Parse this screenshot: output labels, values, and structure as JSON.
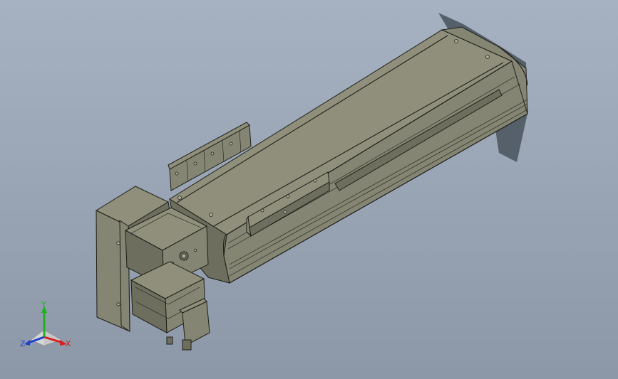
{
  "viewport": {
    "background_top": "#a6b2c2",
    "background_bottom": "#8c98a8"
  },
  "model": {
    "body_color": "#858573",
    "top_face_color": "#8f8f7c",
    "dark_face_color": "#6e6e5e",
    "edge_color": "#1e1e18",
    "shadow_color": "#55606a"
  },
  "triad": {
    "x_label": "X",
    "y_label": "Y",
    "z_label": "Z",
    "x_color": "#d42020",
    "y_color": "#20b020",
    "z_color": "#2040d0"
  }
}
